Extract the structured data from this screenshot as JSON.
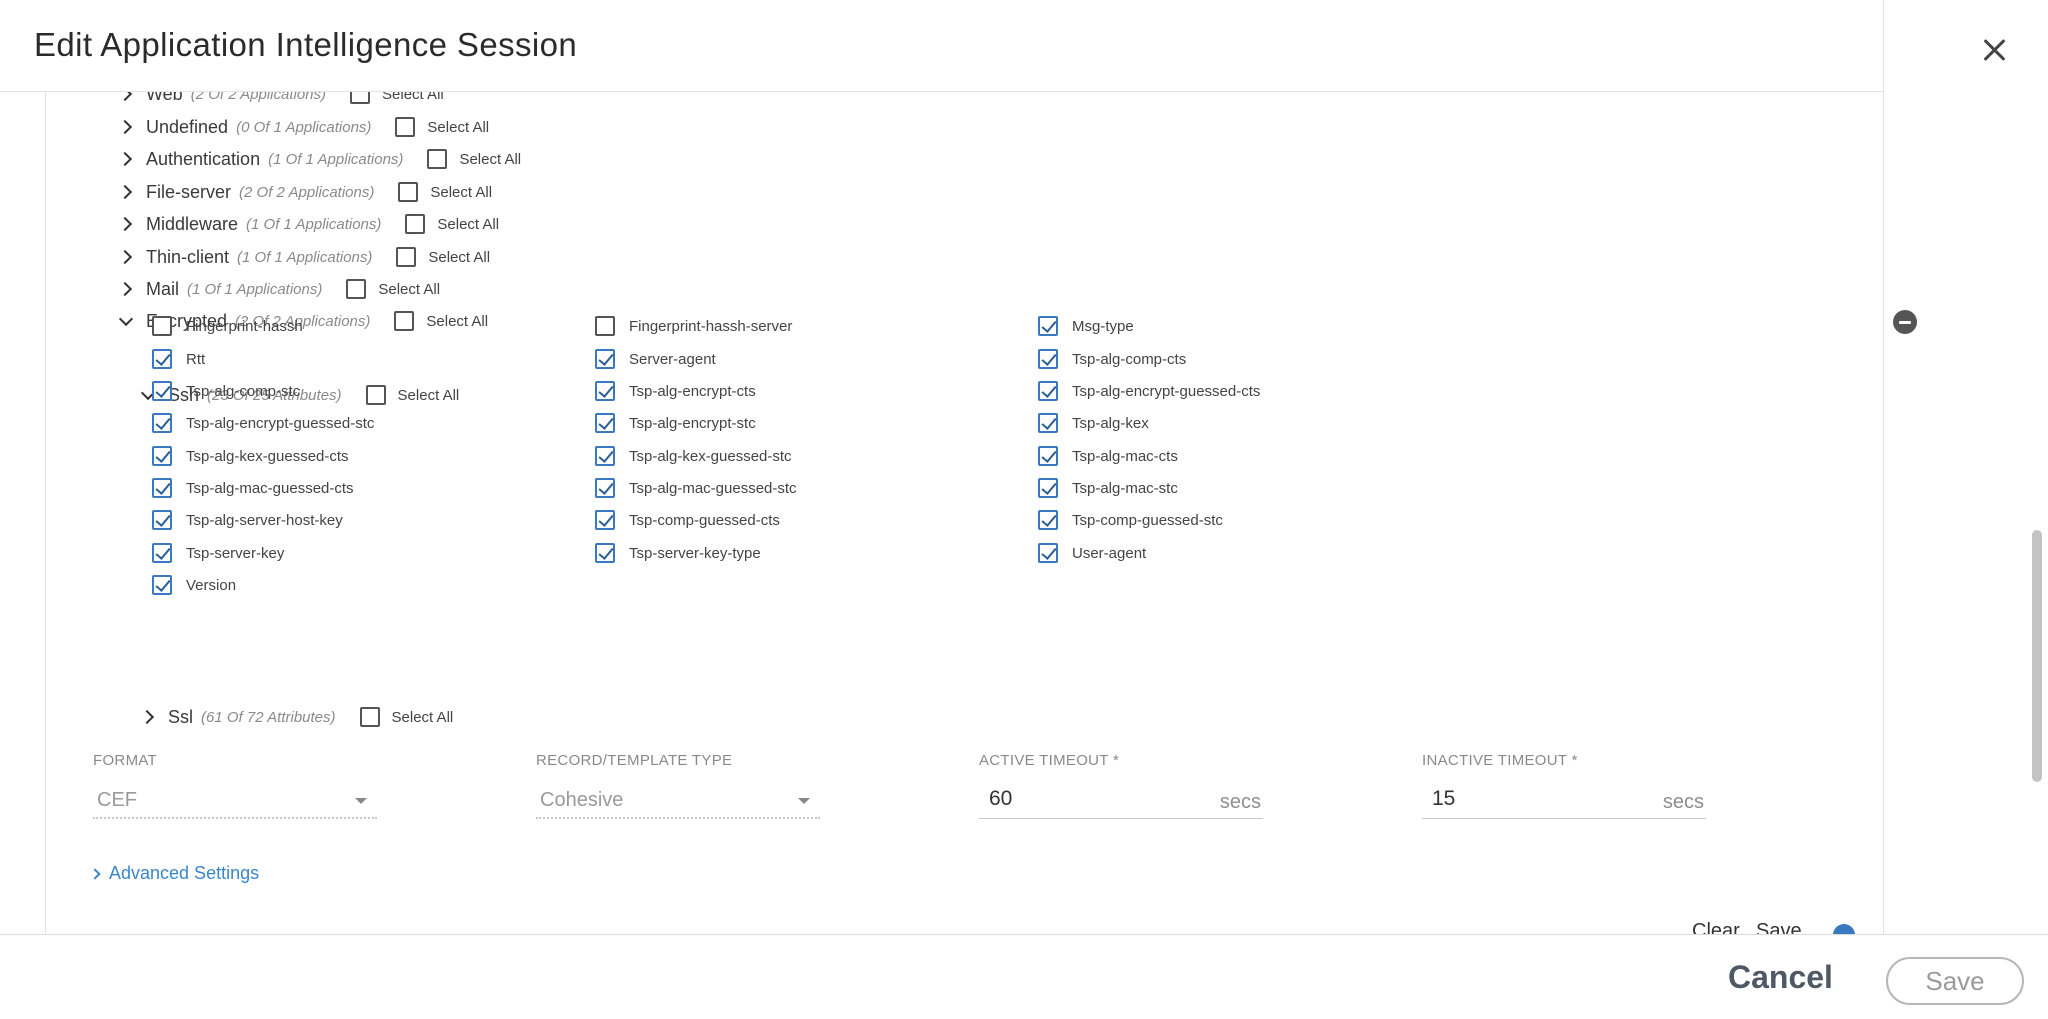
{
  "modal": {
    "title": "Edit Application Intelligence Session",
    "close_label": "×"
  },
  "categories": [
    {
      "name": "Web",
      "count": "(2 Of 2 Applications)",
      "select_all": "Select All",
      "expanded": false,
      "checked": false
    },
    {
      "name": "Undefined",
      "count": "(0 Of 1 Applications)",
      "select_all": "Select All",
      "expanded": false,
      "checked": false
    },
    {
      "name": "Authentication",
      "count": "(1 Of 1 Applications)",
      "select_all": "Select All",
      "expanded": false,
      "checked": false
    },
    {
      "name": "File-server",
      "count": "(2 Of 2 Applications)",
      "select_all": "Select All",
      "expanded": false,
      "checked": false
    },
    {
      "name": "Middleware",
      "count": "(1 Of 1 Applications)",
      "select_all": "Select All",
      "expanded": false,
      "checked": false
    },
    {
      "name": "Thin-client",
      "count": "(1 Of 1 Applications)",
      "select_all": "Select All",
      "expanded": false,
      "checked": false
    },
    {
      "name": "Mail",
      "count": "(1 Of 1 Applications)",
      "select_all": "Select All",
      "expanded": false,
      "checked": false
    },
    {
      "name": "Encrypted",
      "count": "(2 Of 2 Applications)",
      "select_all": "Select All",
      "expanded": true,
      "checked": false
    }
  ],
  "ssh": {
    "name": "Ssh",
    "count": "(23 Of 25 Attributes)",
    "select_all": "Select All",
    "expanded": true,
    "checked": false,
    "attributes": [
      {
        "label": "Fingerprint-hassh",
        "checked": false
      },
      {
        "label": "Fingerprint-hassh-server",
        "checked": false
      },
      {
        "label": "Msg-type",
        "checked": true
      },
      {
        "label": "Rtt",
        "checked": true
      },
      {
        "label": "Server-agent",
        "checked": true
      },
      {
        "label": "Tsp-alg-comp-cts",
        "checked": true
      },
      {
        "label": "Tsp-alg-comp-stc",
        "checked": true
      },
      {
        "label": "Tsp-alg-encrypt-cts",
        "checked": true
      },
      {
        "label": "Tsp-alg-encrypt-guessed-cts",
        "checked": true
      },
      {
        "label": "Tsp-alg-encrypt-guessed-stc",
        "checked": true
      },
      {
        "label": "Tsp-alg-encrypt-stc",
        "checked": true
      },
      {
        "label": "Tsp-alg-kex",
        "checked": true
      },
      {
        "label": "Tsp-alg-kex-guessed-cts",
        "checked": true
      },
      {
        "label": "Tsp-alg-kex-guessed-stc",
        "checked": true
      },
      {
        "label": "Tsp-alg-mac-cts",
        "checked": true
      },
      {
        "label": "Tsp-alg-mac-guessed-cts",
        "checked": true
      },
      {
        "label": "Tsp-alg-mac-guessed-stc",
        "checked": true
      },
      {
        "label": "Tsp-alg-mac-stc",
        "checked": true
      },
      {
        "label": "Tsp-alg-server-host-key",
        "checked": true
      },
      {
        "label": "Tsp-comp-guessed-cts",
        "checked": true
      },
      {
        "label": "Tsp-comp-guessed-stc",
        "checked": true
      },
      {
        "label": "Tsp-server-key",
        "checked": true
      },
      {
        "label": "Tsp-server-key-type",
        "checked": true
      },
      {
        "label": "User-agent",
        "checked": true
      },
      {
        "label": "Version",
        "checked": true
      }
    ]
  },
  "ssl": {
    "name": "Ssl",
    "count": "(61 Of 72 Attributes)",
    "select_all": "Select All",
    "expanded": false,
    "checked": false
  },
  "fields": {
    "format": {
      "label": "FORMAT",
      "value": "CEF"
    },
    "record_type": {
      "label": "RECORD/TEMPLATE TYPE",
      "value": "Cohesive"
    },
    "active_timeout": {
      "label": "ACTIVE TIMEOUT *",
      "value": "60",
      "unit": "secs"
    },
    "inactive_timeout": {
      "label": "INACTIVE TIMEOUT *",
      "value": "15",
      "unit": "secs"
    }
  },
  "advanced_settings": "Advanced Settings",
  "peek_actions": {
    "clear": "Clear",
    "save": "Save"
  },
  "footer": {
    "cancel": "Cancel",
    "save": "Save"
  },
  "colors": {
    "accent": "#3a86c8",
    "checkbox_checked": "#3b78c2"
  }
}
